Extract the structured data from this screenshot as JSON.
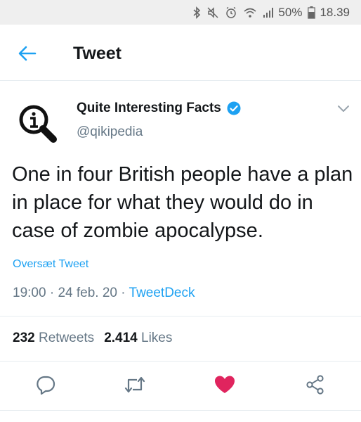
{
  "status_bar": {
    "battery": "50%",
    "time": "18.39"
  },
  "header": {
    "title": "Tweet"
  },
  "tweet": {
    "author_name": "Quite Interesting Facts",
    "author_handle": "@qikipedia",
    "text": "One in four British people have a plan in place for what they would do in case of zombie apocalypse.",
    "translate_label": "Oversæt Tweet",
    "time": "19:00",
    "date": "24 feb. 20",
    "client": "TweetDeck",
    "retweet_count": "232",
    "retweet_label": "Retweets",
    "like_count": "2.414",
    "like_label": "Likes"
  },
  "colors": {
    "accent": "#1da1f2",
    "like": "#e0245e",
    "secondary_text": "#657786"
  },
  "icons": {
    "back": "arrow-left-icon",
    "verified": "verified-badge-icon",
    "more": "chevron-down-icon",
    "reply": "reply-icon",
    "retweet": "retweet-icon",
    "like": "heart-filled-icon",
    "share": "share-icon"
  }
}
